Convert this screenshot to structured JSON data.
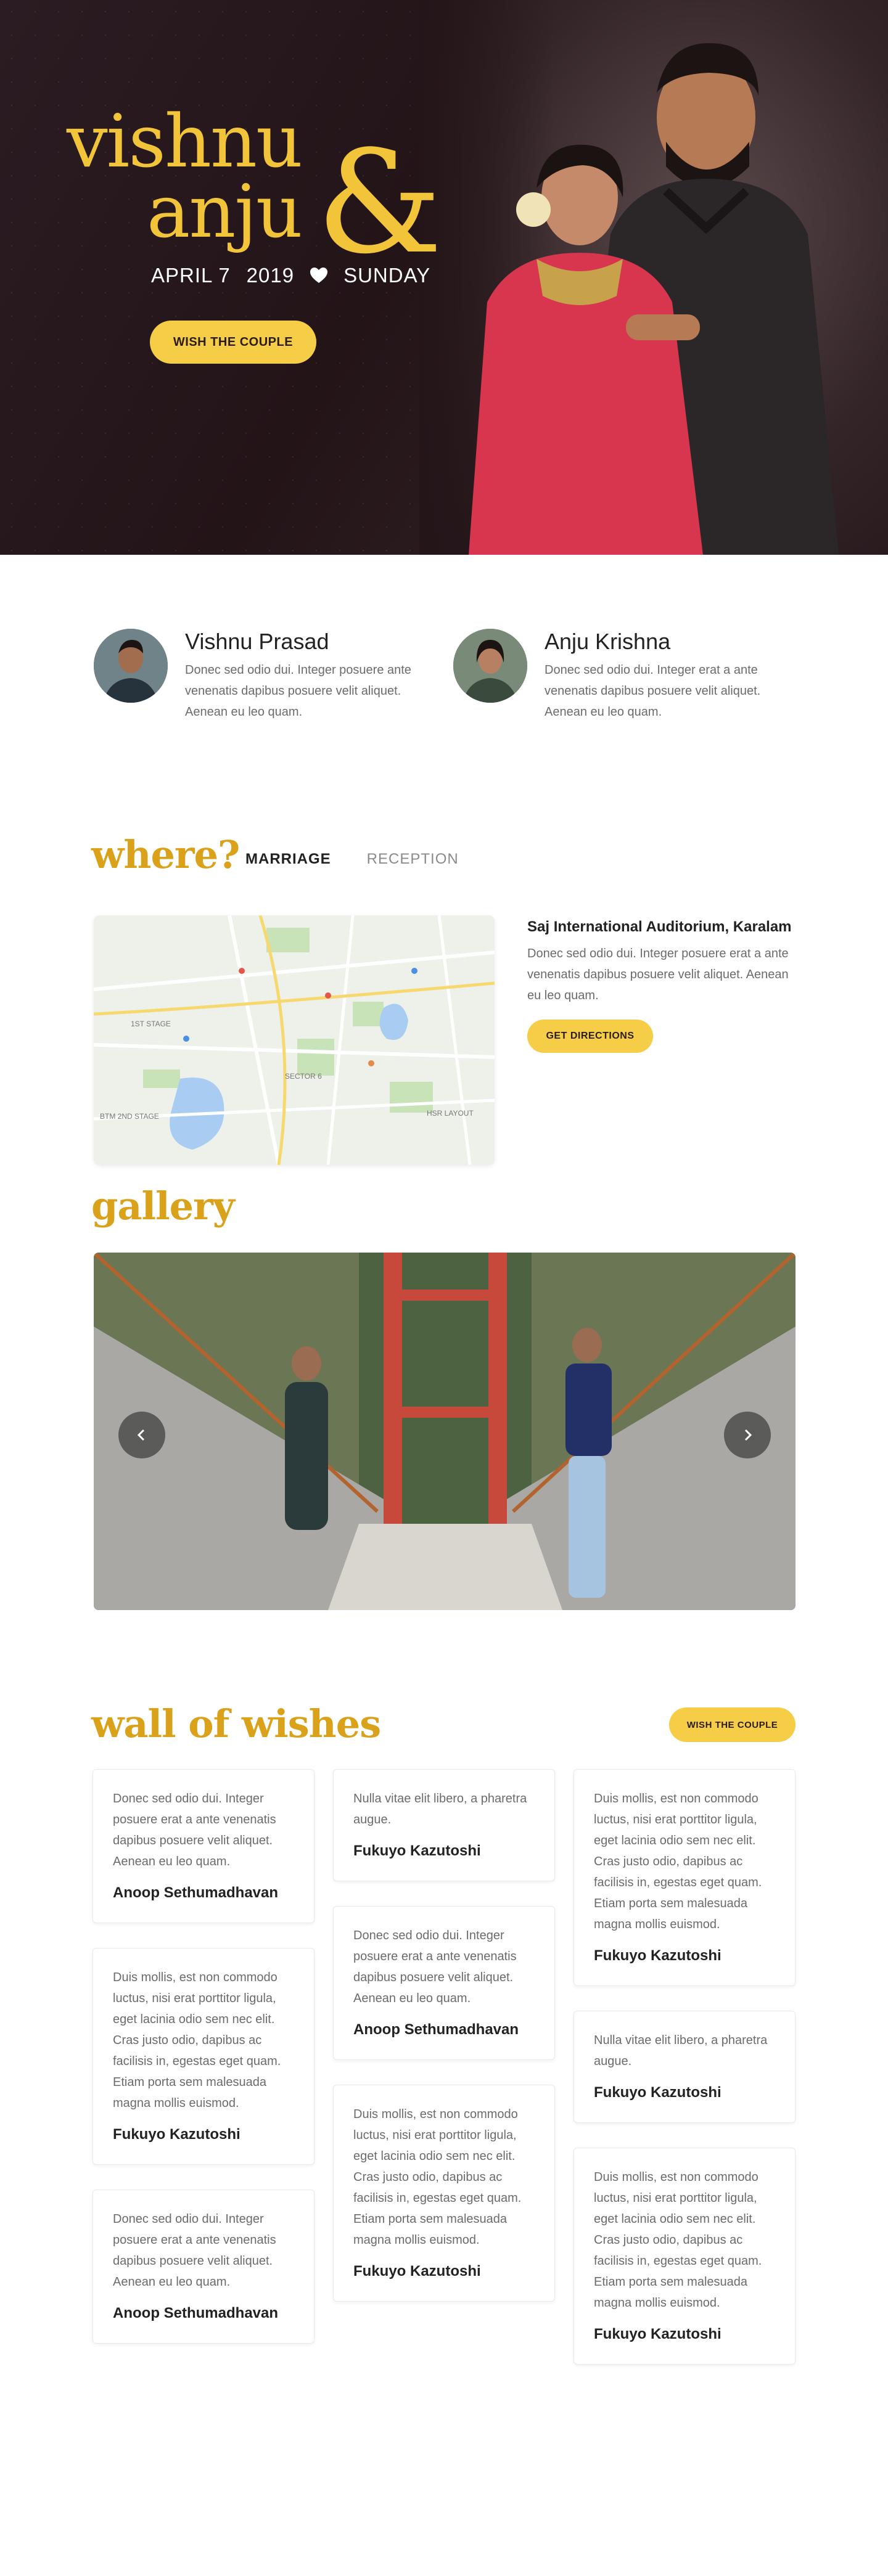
{
  "hero": {
    "name_one": "vishnu",
    "name_two": "anju",
    "ampersand": "&",
    "date": "APRIL 7",
    "year": "2019",
    "day": "SUNDAY",
    "wish_button": "WISH THE COUPLE",
    "heart_icon": "heart-icon"
  },
  "profiles": [
    {
      "name": "Vishnu Prasad",
      "bio": "Donec sed odio dui. Integer posuere ante venenatis dapibus posuere velit aliquet. Aenean eu leo quam."
    },
    {
      "name": "Anju Krishna",
      "bio": "Donec sed odio dui. Integer  erat a ante venenatis dapibus posuere velit aliquet. Aenean eu leo quam."
    }
  ],
  "where": {
    "title": "where?",
    "tabs": [
      "MARRIAGE",
      "RECEPTION"
    ],
    "active_tab": "MARRIAGE",
    "venue_name": "Saj International Auditorium, Karalam",
    "venue_desc": "Donec sed odio dui. Integer posuere erat a ante venenatis dapibus posuere velit aliquet. Aenean eu leo quam.",
    "directions_button": "GET DIRECTIONS",
    "map_labels": [
      "1ST STAGE",
      "SECTOR 6",
      "HSR LAYOUT",
      "BTM 2ND STAGE"
    ]
  },
  "gallery": {
    "title": "gallery",
    "prev_icon": "chevron-left-icon",
    "next_icon": "chevron-right-icon"
  },
  "wishes": {
    "title": "wall of wishes",
    "wish_button": "WISH THE COUPLE",
    "columns": [
      [
        {
          "text": "Donec sed odio dui. Integer posuere erat a ante venenatis dapibus posuere velit aliquet. Aenean eu leo quam.",
          "author": "Anoop Sethumadhavan"
        },
        {
          "text": "Duis mollis, est non commodo luctus, nisi erat porttitor ligula, eget lacinia odio sem nec elit. Cras justo odio, dapibus ac facilisis in, egestas eget quam. Etiam porta sem malesuada magna mollis euismod.",
          "author": "Fukuyo Kazutoshi"
        },
        {
          "text": "Donec sed odio dui. Integer posuere erat a ante venenatis dapibus posuere velit aliquet. Aenean eu leo quam.",
          "author": "Anoop Sethumadhavan"
        }
      ],
      [
        {
          "text": "Nulla vitae elit libero, a pharetra augue.",
          "author": "Fukuyo Kazutoshi"
        },
        {
          "text": "Donec sed odio dui. Integer posuere erat a ante venenatis dapibus posuere velit aliquet. Aenean eu leo quam.",
          "author": "Anoop Sethumadhavan"
        },
        {
          "text": "Duis mollis, est non commodo luctus, nisi erat porttitor ligula, eget lacinia odio sem nec elit. Cras justo odio, dapibus ac facilisis in, egestas eget quam. Etiam porta sem malesuada magna mollis euismod.",
          "author": "Fukuyo Kazutoshi"
        }
      ],
      [
        {
          "text": "Duis mollis, est non commodo luctus, nisi erat porttitor ligula, eget lacinia odio sem nec elit. Cras justo odio, dapibus ac facilisis in, egestas eget quam. Etiam porta sem malesuada magna mollis euismod.",
          "author": "Fukuyo Kazutoshi"
        },
        {
          "text": "Nulla vitae elit libero, a pharetra augue.",
          "author": "Fukuyo Kazutoshi"
        },
        {
          "text": "Duis mollis, est non commodo luctus, nisi erat porttitor ligula, eget lacinia odio sem nec elit. Cras justo odio, dapibus ac facilisis in, egestas eget quam. Etiam porta sem malesuada magna mollis euismod.",
          "author": "Fukuyo Kazutoshi"
        }
      ]
    ]
  },
  "colors": {
    "accent_gold": "#d9a21a",
    "button_yellow": "#f6cd46",
    "hero_bg": "#231418"
  }
}
